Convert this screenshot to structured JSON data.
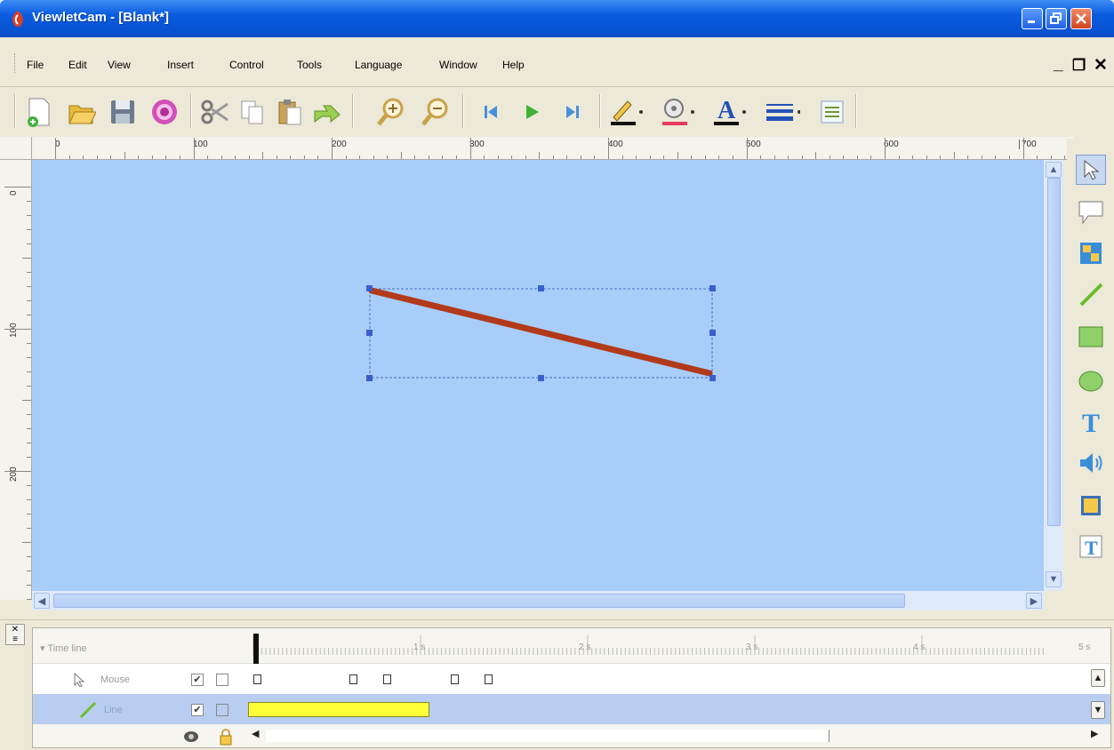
{
  "window": {
    "title": "ViewletCam - [Blank*]"
  },
  "menu": {
    "items": [
      "File",
      "Edit",
      "View",
      "Insert",
      "Control",
      "Tools",
      "Language",
      "Window",
      "Help"
    ]
  },
  "toolbar": {
    "buttons": [
      "new-document",
      "open-folder",
      "save",
      "record",
      "cut",
      "copy",
      "paste",
      "undo",
      "zoom-in",
      "zoom-out",
      "first-frame",
      "play",
      "last-frame",
      "line-color",
      "fill-color",
      "font-color",
      "line-style",
      "properties"
    ]
  },
  "ruler": {
    "h_labels": [
      "0",
      "100",
      "200",
      "300",
      "400",
      "500",
      "600",
      "700"
    ],
    "v_labels": [
      "0",
      "100",
      "200"
    ]
  },
  "canvas": {
    "bg": "#a8cdf8",
    "shape_color": "#b23a1a",
    "handle_color": "#3a5fcc"
  },
  "right_tools": [
    "pointer",
    "callout",
    "image-replace",
    "line",
    "rectangle",
    "ellipse",
    "text",
    "sound",
    "picture",
    "text-box"
  ],
  "timeline": {
    "header": "Time line",
    "seconds": [
      "1 s",
      "2 s",
      "3 s",
      "4 s",
      "5 s"
    ],
    "rows": [
      {
        "name": "Mouse",
        "visible": true
      },
      {
        "name": "Line",
        "visible": true
      }
    ]
  }
}
